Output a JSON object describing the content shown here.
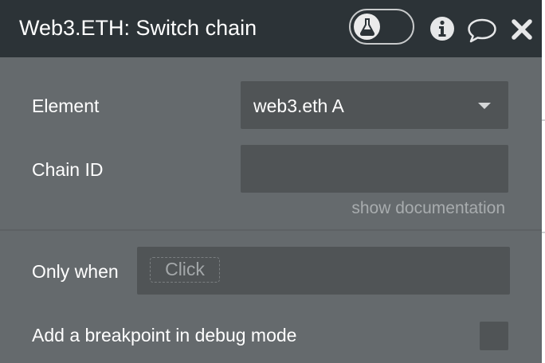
{
  "header": {
    "title": "Web3.ETH: Switch chain",
    "icons": [
      "flask-icon",
      "info-icon",
      "comment-icon",
      "close-icon"
    ]
  },
  "fields": {
    "element_label": "Element",
    "element_value": "web3.eth A",
    "chain_id_label": "Chain ID",
    "chain_id_value": "",
    "doc_link": "show documentation",
    "only_when_label": "Only when",
    "only_when_placeholder": "Click",
    "breakpoint_label": "Add a breakpoint in debug mode",
    "breakpoint_checked": false
  },
  "colors": {
    "header_bg": "#2c3337",
    "panel_bg": "#656a6d",
    "field_bg": "#505456",
    "text": "#ffffff",
    "muted_text": "#a8acae"
  }
}
